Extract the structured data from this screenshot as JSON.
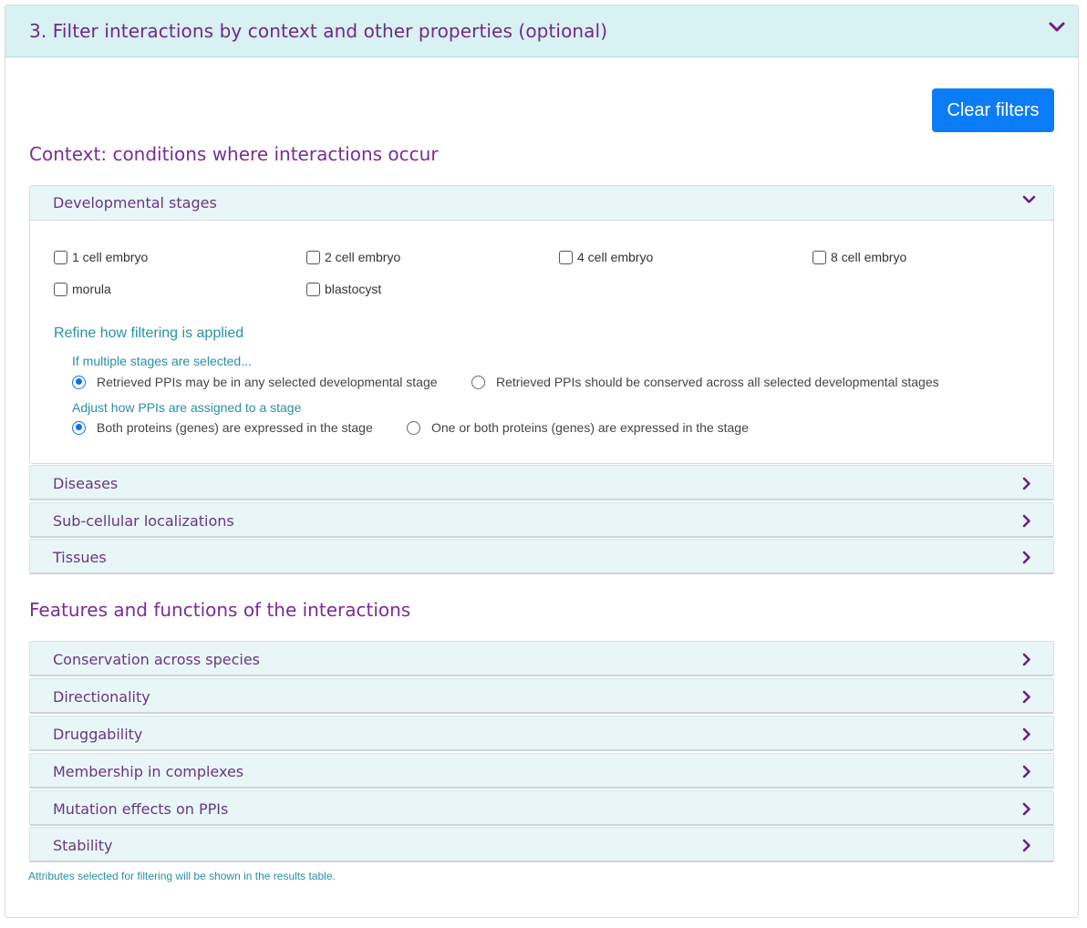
{
  "panel": {
    "title": "3. Filter interactions by context and other properties (optional)"
  },
  "clear_filters_label": "Clear filters",
  "context": {
    "title": "Context: conditions where interactions occur",
    "developmental_stages": {
      "label": "Developmental stages",
      "stages": [
        "1 cell embryo",
        "2 cell embryo",
        "4 cell embryo",
        "8 cell embryo",
        "morula",
        "blastocyst"
      ],
      "refine_title": "Refine how filtering is applied",
      "multiple_title": "If multiple stages are selected...",
      "multiple_options": [
        "Retrieved PPIs may be in any selected developmental stage",
        "Retrieved PPIs should be conserved across all selected developmental stages"
      ],
      "assign_title": "Adjust how PPIs are assigned to a stage",
      "assign_options": [
        "Both proteins (genes) are expressed in the stage",
        "One or both proteins (genes) are expressed in the stage"
      ]
    },
    "collapsed": [
      "Diseases",
      "Sub-cellular localizations",
      "Tissues"
    ]
  },
  "features": {
    "title": "Features and functions of the interactions",
    "collapsed": [
      "Conservation across species",
      "Directionality",
      "Druggability",
      "Membership in complexes",
      "Mutation effects on PPIs",
      "Stability"
    ]
  },
  "footnote": "Attributes selected for filtering will be shown in the results table.",
  "colors": {
    "accent_purple": "#6f2a86",
    "header_bg": "#d8f1f3",
    "button_blue": "#0a7cf8",
    "teal_text": "#2a8fa6"
  }
}
